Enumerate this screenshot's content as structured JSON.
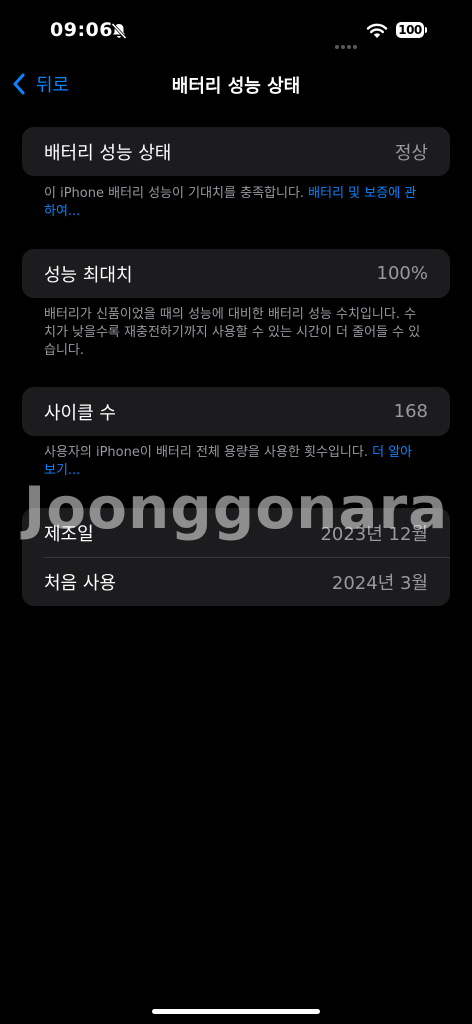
{
  "status_bar": {
    "time": "09:06",
    "battery_level": "100",
    "icons": [
      "bell-slash-icon",
      "cellular-dots-icon",
      "wifi-icon",
      "battery-icon"
    ]
  },
  "nav": {
    "back_label": "뒤로",
    "title": "배터리 성능 상태"
  },
  "sections": [
    {
      "rows": [
        {
          "label": "배터리 성능 상태",
          "value": "정상"
        }
      ],
      "footnote_text": "이 iPhone 배터리 성능이 기대치를 충족합니다. ",
      "footnote_link": "배터리 및 보증에 관하여..."
    },
    {
      "rows": [
        {
          "label": "성능 최대치",
          "value": "100%"
        }
      ],
      "footnote_text": "배터리가 신품이었을 때의 성능에 대비한 배터리 성능 수치입니다. 수치가 낮을수록 재충전하기까지 사용할 수 있는 시간이 더 줄어들 수 있습니다."
    },
    {
      "rows": [
        {
          "label": "사이클 수",
          "value": "168"
        }
      ],
      "footnote_text": "사용자의 iPhone이 배터리 전체 용량을 사용한 횟수입니다. ",
      "footnote_link": "더 알아보기..."
    },
    {
      "rows": [
        {
          "label": "제조일",
          "value": "2023년 12월"
        },
        {
          "label": "처음 사용",
          "value": "2024년 3월"
        }
      ]
    }
  ],
  "watermark": "Joonggonara",
  "colors": {
    "background": "#000000",
    "group_background": "#1c1c1e",
    "accent": "#0a84ff",
    "secondary_text": "#98989f"
  }
}
